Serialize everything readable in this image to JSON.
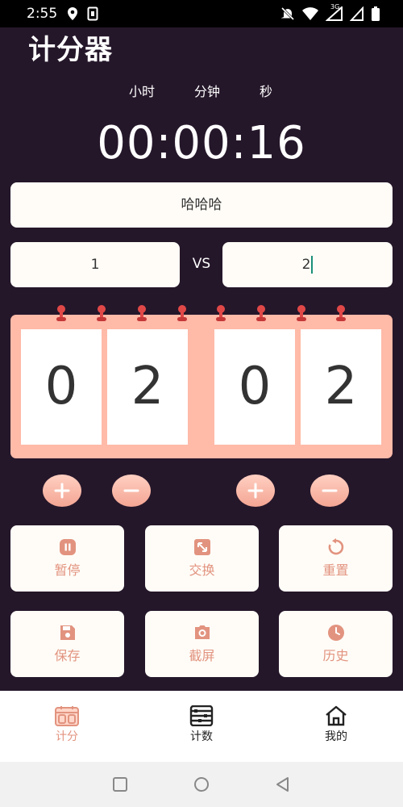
{
  "status_bar": {
    "time": "2:55",
    "network_label": "3G"
  },
  "app": {
    "title": "计分器"
  },
  "timer": {
    "labels": {
      "hours": "小时",
      "minutes": "分钟",
      "seconds": "秒"
    },
    "value": "00:00:16"
  },
  "match": {
    "name": "哈哈哈",
    "team_left": "1",
    "vs_label": "VS",
    "team_right": "2"
  },
  "scoreboard": {
    "left_digits": [
      "0",
      "2"
    ],
    "right_digits": [
      "0",
      "2"
    ]
  },
  "actions": [
    {
      "label": "暂停",
      "icon": "pause-icon"
    },
    {
      "label": "交换",
      "icon": "swap-icon"
    },
    {
      "label": "重置",
      "icon": "reset-icon"
    },
    {
      "label": "保存",
      "icon": "save-icon"
    },
    {
      "label": "截屏",
      "icon": "camera-icon"
    },
    {
      "label": "历史",
      "icon": "clock-icon"
    }
  ],
  "bottom_nav": [
    {
      "label": "计分",
      "icon": "scoreboard-icon",
      "active": true
    },
    {
      "label": "计数",
      "icon": "abacus-icon",
      "active": false
    },
    {
      "label": "我的",
      "icon": "home-icon",
      "active": false
    }
  ],
  "colors": {
    "background": "#25172a",
    "board": "#ffbaa8",
    "accent": "#e2937f",
    "card": "#fffcf7",
    "pin": "#e04848"
  }
}
